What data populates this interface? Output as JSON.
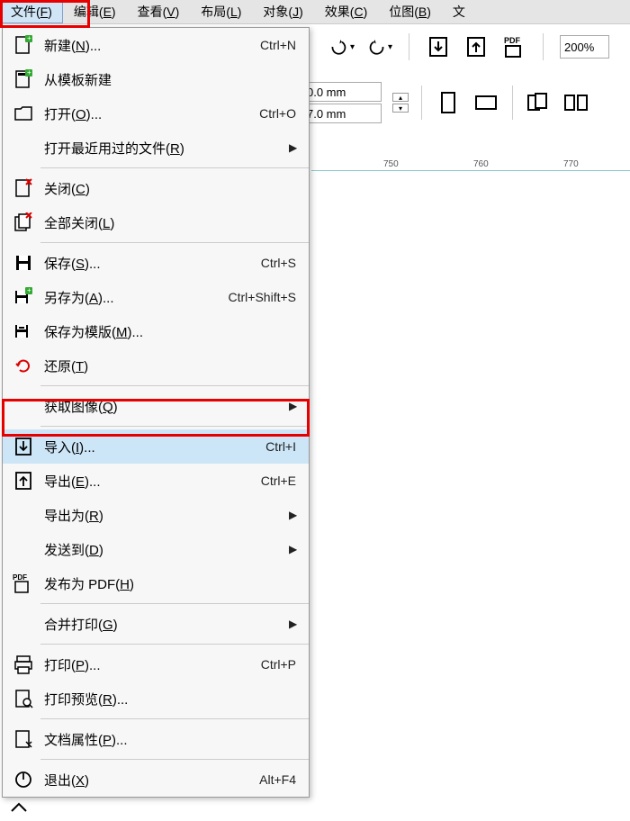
{
  "menubar": {
    "items": [
      {
        "label": "文件",
        "key": "F"
      },
      {
        "label": "编辑",
        "key": "E"
      },
      {
        "label": "查看",
        "key": "V"
      },
      {
        "label": "布局",
        "key": "L"
      },
      {
        "label": "对象",
        "key": "J"
      },
      {
        "label": "效果",
        "key": "C"
      },
      {
        "label": "位图",
        "key": "B"
      },
      {
        "label": "文",
        "key": ""
      }
    ]
  },
  "dropdown": {
    "items": [
      {
        "icon": "new-doc",
        "label": "新建",
        "key": "N",
        "suffix": "...",
        "shortcut": "Ctrl+N",
        "arrow": false
      },
      {
        "icon": "new-template",
        "label": "从模板新建",
        "key": "",
        "suffix": "",
        "shortcut": "",
        "arrow": false
      },
      {
        "icon": "open-folder",
        "label": "打开",
        "key": "O",
        "suffix": "...",
        "shortcut": "Ctrl+O",
        "arrow": false
      },
      {
        "icon": "",
        "label": "打开最近用过的文件",
        "key": "R",
        "suffix": "",
        "shortcut": "",
        "arrow": true
      },
      {
        "sep": true
      },
      {
        "icon": "close",
        "label": "关闭",
        "key": "C",
        "suffix": "",
        "shortcut": "",
        "arrow": false
      },
      {
        "icon": "close-all",
        "label": "全部关闭",
        "key": "L",
        "suffix": "",
        "shortcut": "",
        "arrow": false
      },
      {
        "sep": true
      },
      {
        "icon": "save",
        "label": "保存",
        "key": "S",
        "suffix": "...",
        "shortcut": "Ctrl+S",
        "arrow": false
      },
      {
        "icon": "save-as",
        "label": "另存为",
        "key": "A",
        "suffix": "...",
        "shortcut": "Ctrl+Shift+S",
        "arrow": false
      },
      {
        "icon": "save-template",
        "label": "保存为模版",
        "key": "M",
        "suffix": "...",
        "shortcut": "",
        "arrow": false
      },
      {
        "icon": "revert",
        "label": "还原",
        "key": "T",
        "suffix": "",
        "shortcut": "",
        "arrow": false
      },
      {
        "sep": true
      },
      {
        "icon": "",
        "label": "获取图像",
        "key": "Q",
        "suffix": "",
        "shortcut": "",
        "arrow": true
      },
      {
        "sep": true
      },
      {
        "icon": "import",
        "label": "导入",
        "key": "I",
        "suffix": "...",
        "shortcut": "Ctrl+I",
        "arrow": false,
        "highlighted": true
      },
      {
        "icon": "export",
        "label": "导出",
        "key": "E",
        "suffix": "...",
        "shortcut": "Ctrl+E",
        "arrow": false
      },
      {
        "icon": "",
        "label": "导出为",
        "key": "R",
        "suffix": "",
        "shortcut": "",
        "arrow": true
      },
      {
        "icon": "",
        "label": "发送到",
        "key": "D",
        "suffix": "",
        "shortcut": "",
        "arrow": true
      },
      {
        "icon": "pdf",
        "label": "发布为 PDF",
        "key": "H",
        "suffix": "",
        "shortcut": "",
        "arrow": false
      },
      {
        "sep": true
      },
      {
        "icon": "",
        "label": "合并打印",
        "key": "G",
        "suffix": "",
        "shortcut": "",
        "arrow": true
      },
      {
        "sep": true
      },
      {
        "icon": "print",
        "label": "打印",
        "key": "P",
        "suffix": "...",
        "shortcut": "Ctrl+P",
        "arrow": false
      },
      {
        "icon": "print-preview",
        "label": "打印预览",
        "key": "R",
        "suffix": "...",
        "shortcut": "",
        "arrow": false
      },
      {
        "sep": true
      },
      {
        "icon": "doc-props",
        "label": "文档属性",
        "key": "P",
        "suffix": "...",
        "shortcut": "",
        "arrow": false
      },
      {
        "sep": true
      },
      {
        "icon": "exit",
        "label": "退出",
        "key": "X",
        "suffix": "",
        "shortcut": "Alt+F4",
        "arrow": false
      }
    ]
  },
  "toolbar": {
    "zoom": "200%"
  },
  "properties": {
    "width": "0.0 mm",
    "height": "7.0 mm"
  },
  "ruler": {
    "ticks": [
      "750",
      "760",
      "770"
    ]
  }
}
